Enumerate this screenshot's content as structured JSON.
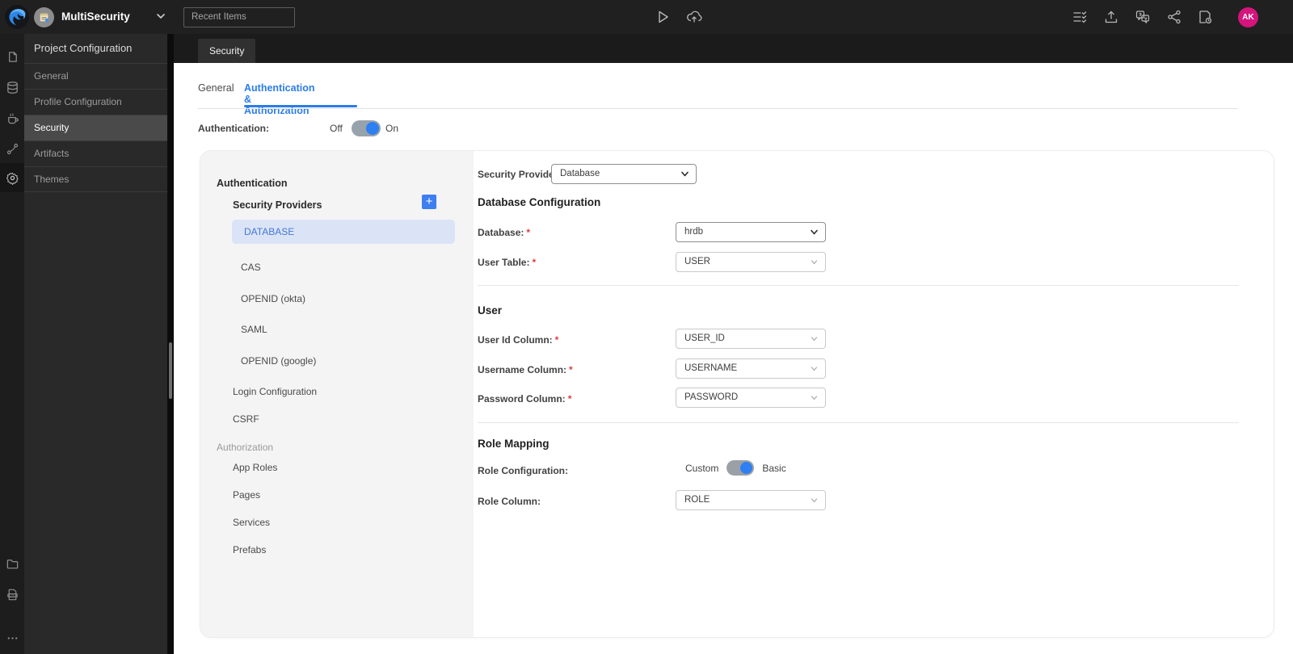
{
  "topbar": {
    "project_name": "MultiSecurity",
    "recent_items": "Recent Items",
    "avatar_initials": "AK"
  },
  "sidebar": {
    "title": "Project Configuration",
    "items": [
      {
        "label": "General"
      },
      {
        "label": "Profile Configuration"
      },
      {
        "label": "Security"
      },
      {
        "label": "Artifacts"
      },
      {
        "label": "Themes"
      }
    ]
  },
  "tabstrip": {
    "active_tab": "Security"
  },
  "page": {
    "tabs": {
      "general": "General",
      "auth": "Authentication & Authorization"
    },
    "authentication_label": "Authentication:",
    "toggle_off": "Off",
    "toggle_on": "On",
    "toggle_state": "on"
  },
  "nav": {
    "section_authentication": "Authentication",
    "security_providers_label": "Security Providers",
    "providers": [
      "DATABASE",
      "CAS",
      "OPENID (okta)",
      "SAML",
      "OPENID (google)"
    ],
    "selected_provider": "DATABASE",
    "login_configuration": "Login Configuration",
    "csrf": "CSRF",
    "section_authorization": "Authorization",
    "authorization_items": [
      "App Roles",
      "Pages",
      "Services",
      "Prefabs"
    ]
  },
  "form": {
    "required_marker": "*",
    "security_provider": {
      "label": "Security Provider",
      "value": "Database"
    },
    "database_configuration_heading": "Database Configuration",
    "database": {
      "label": "Database:",
      "value": "hrdb"
    },
    "user_table": {
      "label": "User Table:",
      "value": "USER"
    },
    "user_heading": "User",
    "user_id_column": {
      "label": "User Id Column:",
      "value": "USER_ID"
    },
    "username_column": {
      "label": "Username Column:",
      "value": "USERNAME"
    },
    "password_column": {
      "label": "Password Column:",
      "value": "PASSWORD"
    },
    "role_mapping_heading": "Role Mapping",
    "role_configuration": {
      "label": "Role Configuration:",
      "left": "Custom",
      "right": "Basic",
      "state": "right"
    },
    "role_column": {
      "label": "Role Column:",
      "value": "ROLE"
    }
  },
  "colors": {
    "accent_blue": "#2b7de9",
    "selected_provider_bg": "#dbe4f7",
    "avatar_pink": "#d5147c",
    "toggle_knob": "#2d7ff2"
  }
}
